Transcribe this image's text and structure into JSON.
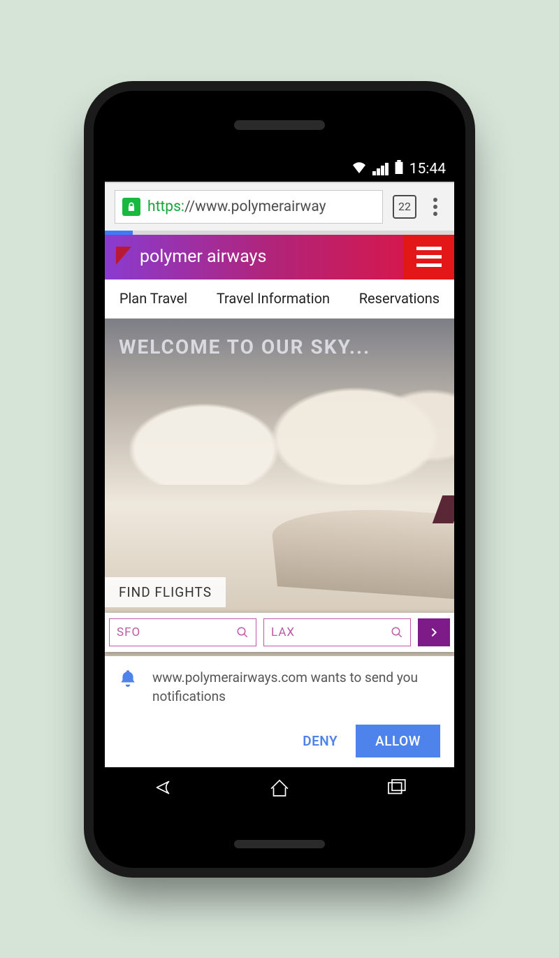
{
  "status": {
    "time": "15:44"
  },
  "browser": {
    "url_scheme": "https:",
    "url_rest": "//www.polymerairway",
    "tab_count": "22"
  },
  "site": {
    "brand": "polymer airways",
    "nav": [
      "Plan Travel",
      "Travel Information",
      "Reservations"
    ],
    "hero_title": "WELCOME TO OUR SKY...",
    "find_label": "FIND FLIGHTS",
    "from": "SFO",
    "to": "LAX"
  },
  "prompt": {
    "message": "www.polymerairways.com wants to send you notifications",
    "deny": "DENY",
    "allow": "ALLOW"
  }
}
